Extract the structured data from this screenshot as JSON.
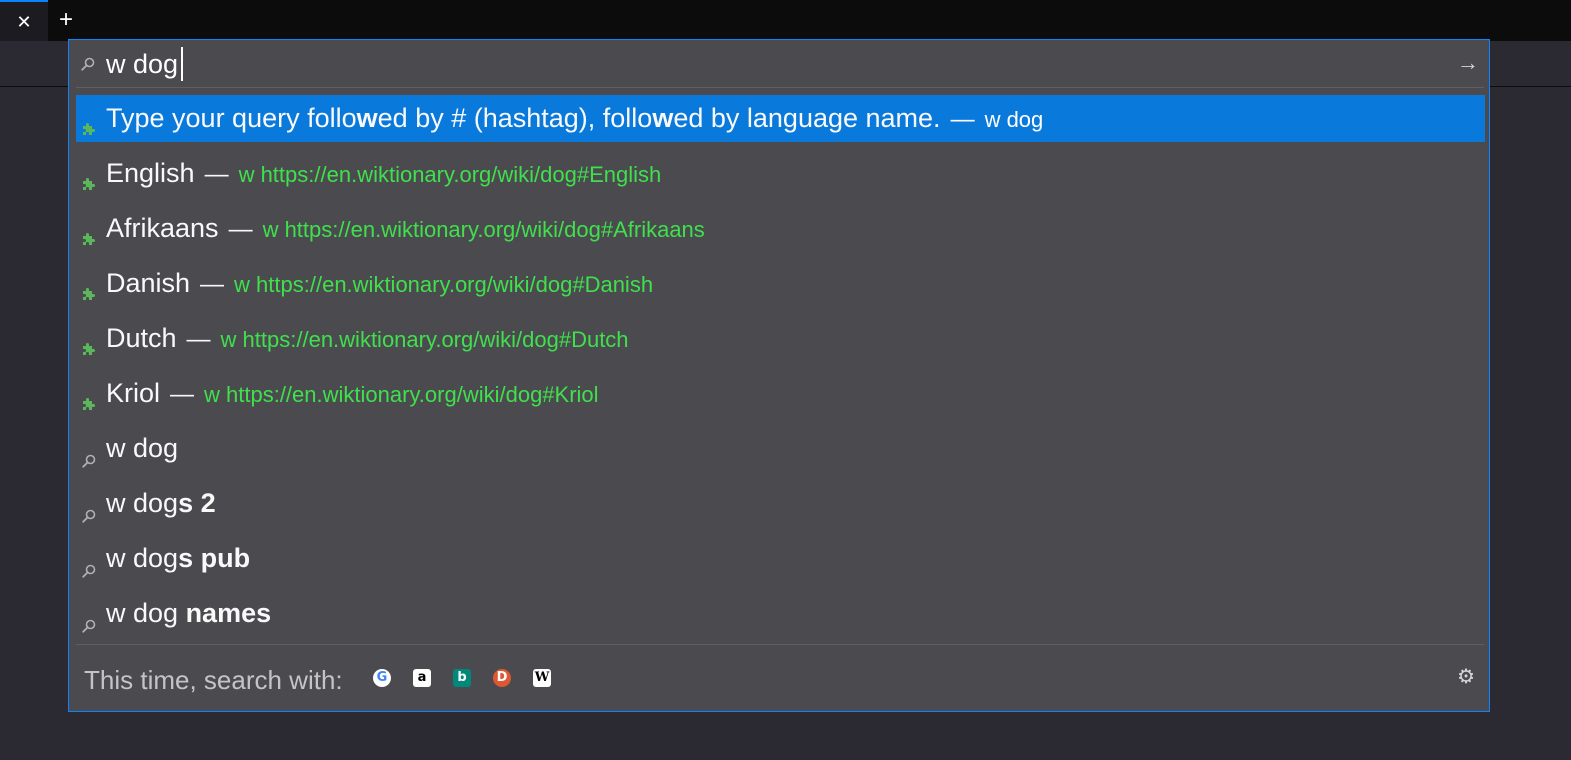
{
  "tabbar": {
    "close_glyph": "✕",
    "new_tab_glyph": "+"
  },
  "urlbar": {
    "value": "w dog",
    "go_glyph": "→"
  },
  "results": [
    {
      "kind": "extension",
      "icon": "puzzle-icon",
      "selected": true,
      "parts": [
        {
          "text": "Type your query follo",
          "bold": false
        },
        {
          "text": "w",
          "bold": true
        },
        {
          "text": "ed by # (hashtag), follo",
          "bold": false
        },
        {
          "text": "w",
          "bold": true
        },
        {
          "text": "ed by language name.",
          "bold": false
        }
      ],
      "dash": "—",
      "url": "w dog"
    },
    {
      "kind": "extension",
      "icon": "puzzle-icon",
      "parts": [
        {
          "text": "English",
          "bold": false
        }
      ],
      "dash": "—",
      "url": "w https://en.wiktionary.org/wiki/dog#English"
    },
    {
      "kind": "extension",
      "icon": "puzzle-icon",
      "parts": [
        {
          "text": "Afrikaans",
          "bold": false
        }
      ],
      "dash": "—",
      "url": "w https://en.wiktionary.org/wiki/dog#Afrikaans"
    },
    {
      "kind": "extension",
      "icon": "puzzle-icon",
      "parts": [
        {
          "text": "Danish",
          "bold": false
        }
      ],
      "dash": "—",
      "url": "w https://en.wiktionary.org/wiki/dog#Danish"
    },
    {
      "kind": "extension",
      "icon": "puzzle-icon",
      "parts": [
        {
          "text": "Dutch",
          "bold": false
        }
      ],
      "dash": "—",
      "url": "w https://en.wiktionary.org/wiki/dog#Dutch"
    },
    {
      "kind": "extension",
      "icon": "puzzle-icon",
      "parts": [
        {
          "text": "Kriol",
          "bold": false
        }
      ],
      "dash": "—",
      "url": "w https://en.wiktionary.org/wiki/dog#Kriol"
    },
    {
      "kind": "search",
      "icon": "search-icon",
      "parts": [
        {
          "text": "w dog",
          "bold": false
        }
      ]
    },
    {
      "kind": "search",
      "icon": "search-icon",
      "parts": [
        {
          "text": "w dog",
          "bold": false
        },
        {
          "text": "s 2",
          "bold": true
        }
      ]
    },
    {
      "kind": "search",
      "icon": "search-icon",
      "parts": [
        {
          "text": "w dog",
          "bold": false
        },
        {
          "text": "s pub",
          "bold": true
        }
      ]
    },
    {
      "kind": "search",
      "icon": "search-icon",
      "parts": [
        {
          "text": "w dog ",
          "bold": false
        },
        {
          "text": "names",
          "bold": true
        }
      ]
    }
  ],
  "footer": {
    "label": "This time, search with:",
    "engines": [
      {
        "name": "google-icon",
        "glyph": "G"
      },
      {
        "name": "amazon-icon",
        "glyph": "a"
      },
      {
        "name": "bing-icon",
        "glyph": "b"
      },
      {
        "name": "duckduckgo-icon",
        "glyph": "D"
      },
      {
        "name": "wikipedia-icon",
        "glyph": "W"
      }
    ],
    "settings_glyph": "⚙"
  },
  "colors": {
    "accent": "#0a84ff",
    "selected_row": "#0a79dc",
    "url_green": "#3fe04c",
    "popup_bg": "#4a4a4f",
    "extension_icon": "#5bb85a"
  }
}
